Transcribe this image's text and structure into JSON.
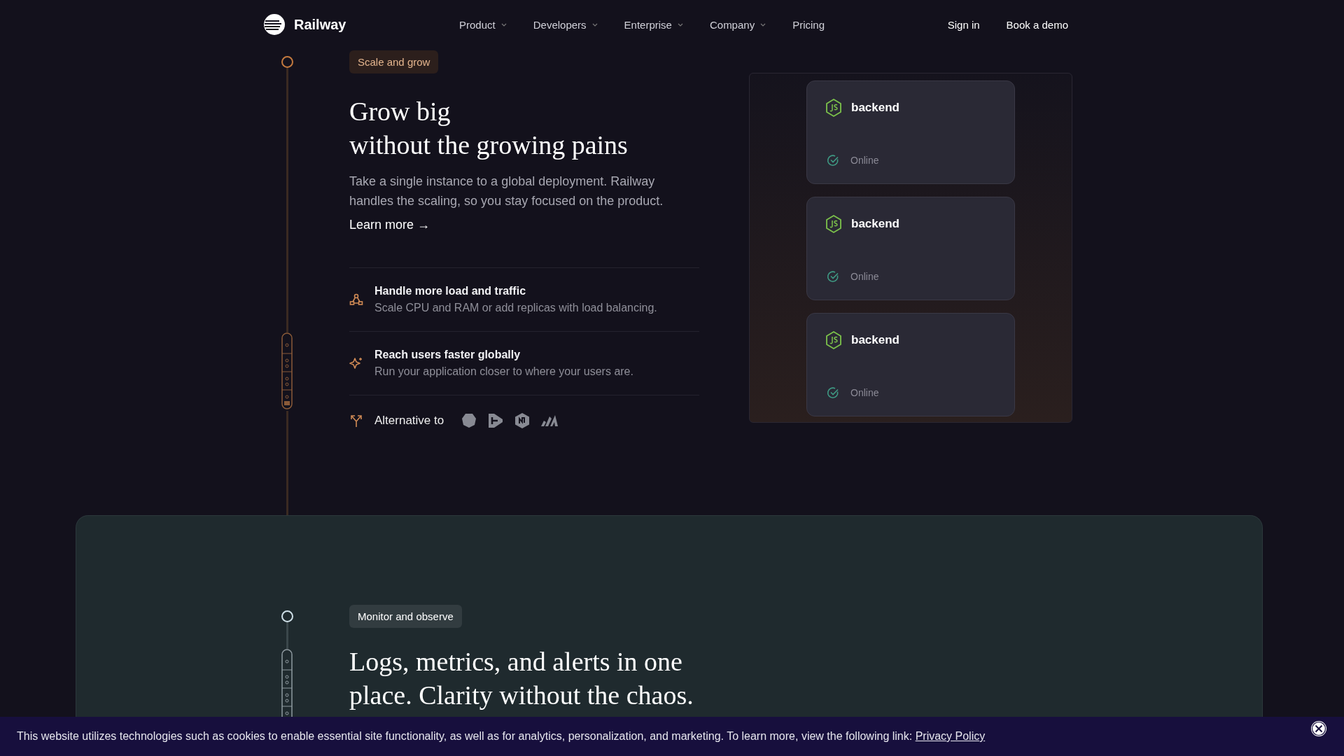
{
  "nav": {
    "logo": "Railway",
    "items": [
      {
        "label": "Product",
        "has_menu": true
      },
      {
        "label": "Developers",
        "has_menu": true
      },
      {
        "label": "Enterprise",
        "has_menu": true
      },
      {
        "label": "Company",
        "has_menu": true
      },
      {
        "label": "Pricing",
        "has_menu": false
      }
    ],
    "sign_in": "Sign in",
    "cta": "Book a demo"
  },
  "scale": {
    "tag": "Scale and grow",
    "heading": "Grow big\nwithout the growing pains",
    "text": "Take a single instance to a global deployment. Railway handles the scaling, so you stay focused on the product.",
    "link": "Learn more →",
    "features": [
      {
        "kind": "nodes",
        "title": "Handle more load and traffic",
        "text": "Scale CPU and RAM or add replicas with load balancing."
      },
      {
        "kind": "sparkle",
        "title": "Reach users faster globally",
        "text": "Run your application closer to where your users are."
      }
    ],
    "alternative": "Alternative to",
    "services": [
      {
        "name": "backend",
        "status": "Online"
      },
      {
        "name": "backend",
        "status": "Online"
      },
      {
        "name": "backend",
        "status": "Online"
      }
    ]
  },
  "monitor": {
    "tag": "Monitor and observe",
    "heading": "Logs, metrics, and alerts in one place. Clarity without the chaos."
  },
  "cookie": {
    "text": "This website utilizes technologies such as cookies to enable essential site functionality, as well as for analytics, personalization, and marketing. To learn more, view the following link:",
    "link": "Privacy Policy"
  }
}
